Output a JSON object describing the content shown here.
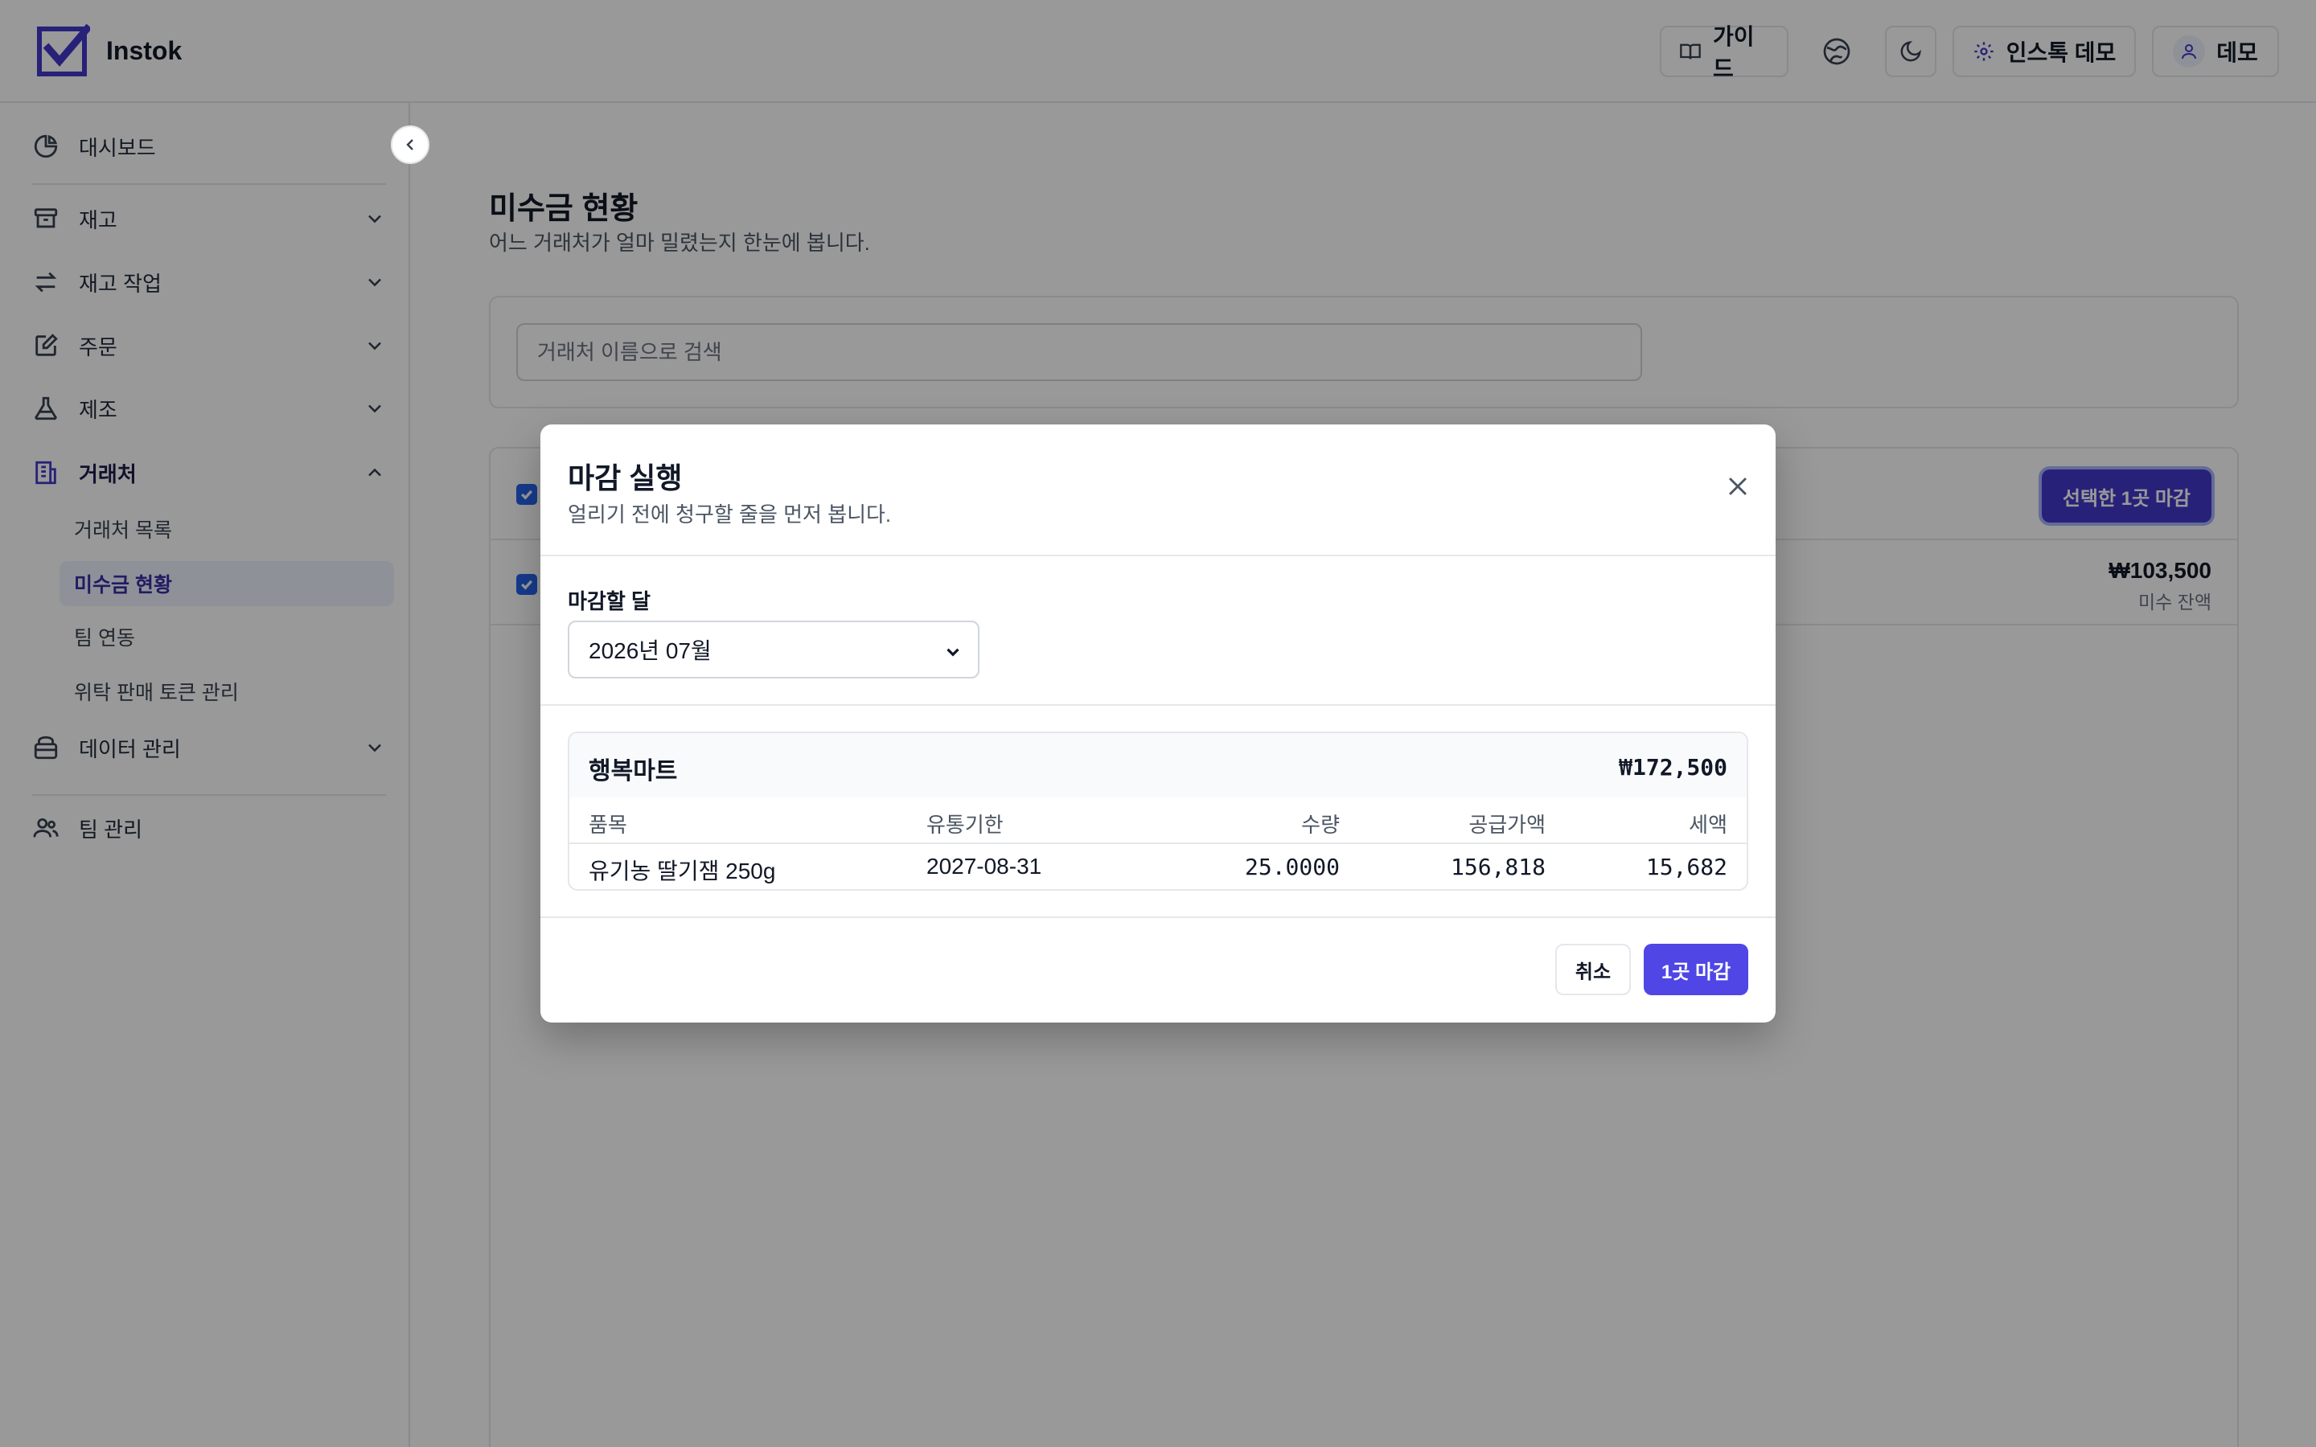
{
  "app": {
    "name": "Instok"
  },
  "header": {
    "guide_label": "가이드",
    "org_label": "인스톡 데모",
    "user_label": "데모"
  },
  "sidebar": {
    "items": [
      {
        "label": "대시보드",
        "icon": "pie-chart-icon"
      },
      {
        "label": "재고",
        "icon": "archive-icon"
      },
      {
        "label": "재고 작업",
        "icon": "arrows-swap-icon"
      },
      {
        "label": "주문",
        "icon": "edit-icon"
      },
      {
        "label": "제조",
        "icon": "flask-icon"
      },
      {
        "label": "거래처",
        "icon": "building-icon"
      },
      {
        "label": "데이터 관리",
        "icon": "database-icon"
      },
      {
        "label": "팀 관리",
        "icon": "users-icon"
      }
    ],
    "subitems": [
      {
        "label": "거래처 목록"
      },
      {
        "label": "미수금 현황"
      },
      {
        "label": "팀 연동"
      },
      {
        "label": "위탁 판매 토큰 관리"
      }
    ]
  },
  "main": {
    "title": "미수금 현황",
    "subtitle": "어느 거래처가 얼마 밀렸는지 한눈에 봅니다.",
    "search_placeholder": "거래처 이름으로 검색",
    "bulk_button": "선택한 1곳 마감",
    "row": {
      "amount": "₩103,500",
      "amount_label": "미수 잔액"
    }
  },
  "modal": {
    "title": "마감 실행",
    "subtitle": "얼리기 전에 청구할 줄을 먼저 봅니다.",
    "field_label": "마감할 달",
    "selected_month": "2026년 07월",
    "vendor": {
      "name": "행복마트",
      "total": "₩172,500"
    },
    "columns": [
      "품목",
      "유통기한",
      "수량",
      "공급가액",
      "세액"
    ],
    "rows": [
      {
        "item": "유기농 딸기잼 250g",
        "expiry": "2027-08-31",
        "qty": "25.0000",
        "supply": "156,818",
        "tax": "15,682"
      }
    ],
    "cancel_label": "취소",
    "confirm_label": "1곳 마감"
  },
  "colors": {
    "brand": "#4338ca",
    "accent": "#4f46e5",
    "checkbox": "#2563eb"
  }
}
